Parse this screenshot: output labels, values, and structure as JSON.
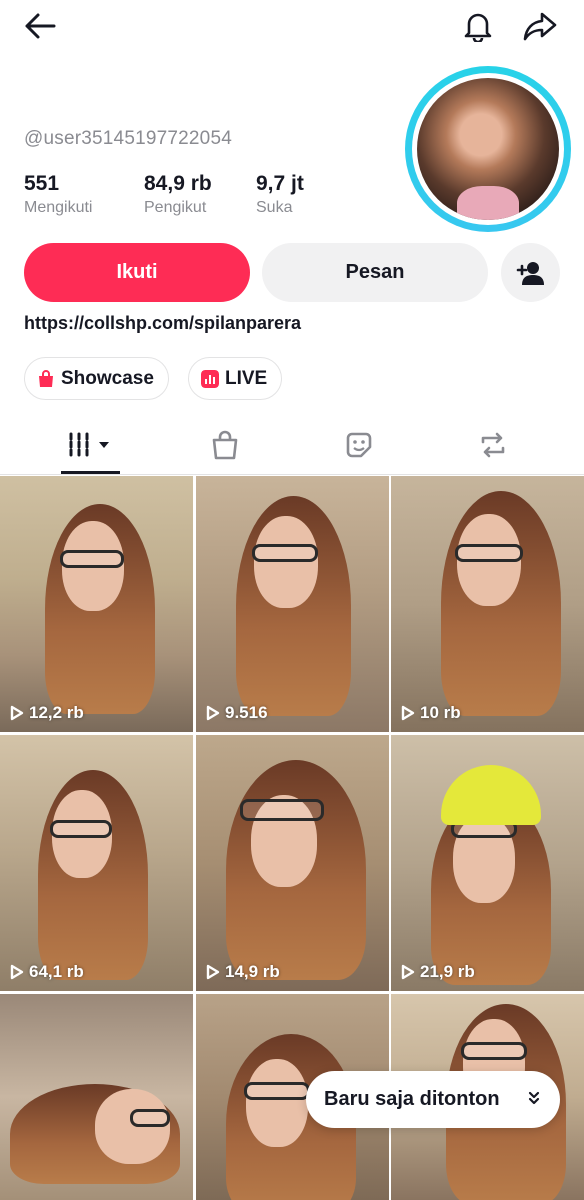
{
  "profile": {
    "username": "@user35145197722054",
    "stats": [
      {
        "value": "551",
        "label": "Mengikuti"
      },
      {
        "value": "84,9 rb",
        "label": "Pengikut"
      },
      {
        "value": "9,7 jt",
        "label": "Suka"
      }
    ],
    "bio_link": "https://collshp.com/spilanparera"
  },
  "actions": {
    "follow_label": "Ikuti",
    "message_label": "Pesan"
  },
  "chips": {
    "showcase_label": "Showcase",
    "live_label": "LIVE"
  },
  "tabs": [
    {
      "icon": "videos-grid-icon",
      "active": true
    },
    {
      "icon": "shopping-bag-icon",
      "active": false
    },
    {
      "icon": "sticker-icon",
      "active": false
    },
    {
      "icon": "repost-icon",
      "active": false
    }
  ],
  "videos": [
    {
      "views": "12,2 rb"
    },
    {
      "views": "9.516"
    },
    {
      "views": "10 rb"
    },
    {
      "views": "64,1 rb"
    },
    {
      "views": "14,9 rb"
    },
    {
      "views": "21,9 rb"
    },
    {
      "views": ""
    },
    {
      "views": ""
    },
    {
      "views": ""
    }
  ],
  "toast": {
    "label": "Baru saja ditonton"
  },
  "colors": {
    "accent": "#fe2c55",
    "avatar_ring": "#27d3e8",
    "secondary_bg": "#f1f1f2",
    "muted_text": "#8a8b91"
  }
}
